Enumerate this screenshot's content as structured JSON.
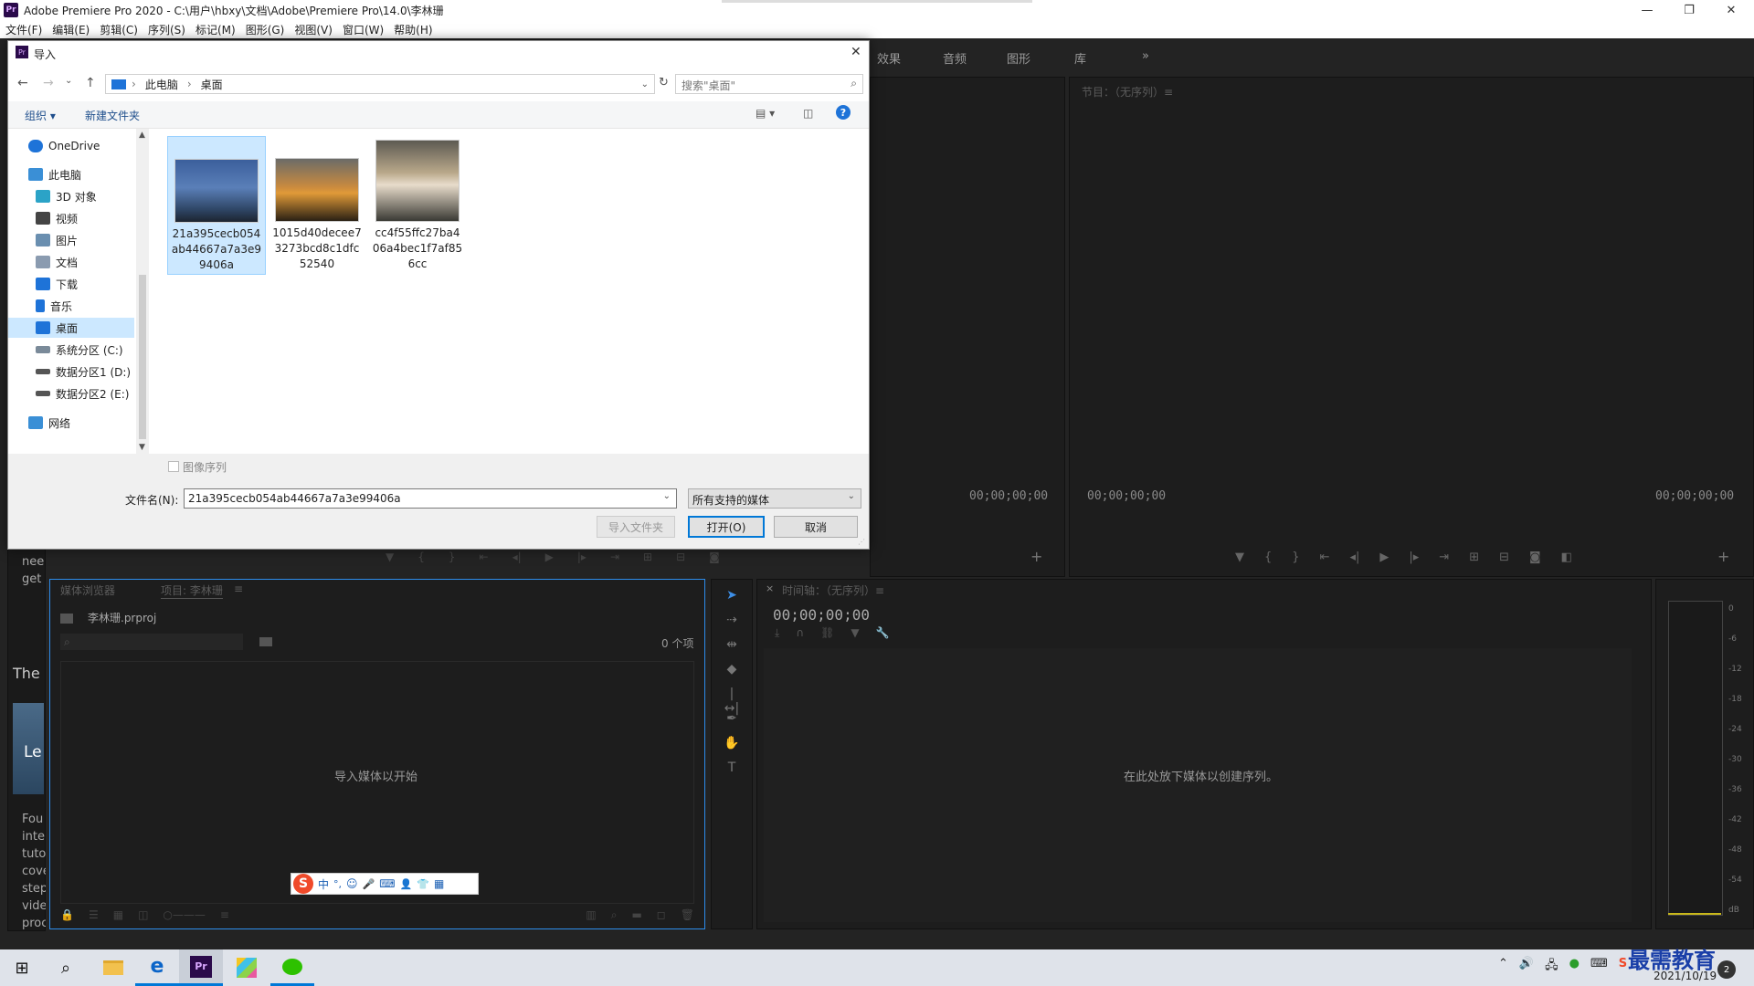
{
  "app": {
    "title": "Adobe Premiere Pro 2020 - C:\\用户\\hbxy\\文档\\Adobe\\Premiere Pro\\14.0\\李林珊",
    "menu": [
      "文件(F)",
      "编辑(E)",
      "剪辑(C)",
      "序列(S)",
      "标记(M)",
      "图形(G)",
      "视图(V)",
      "窗口(W)",
      "帮助(H)"
    ],
    "workspace_tabs": [
      "效果",
      "音频",
      "图形",
      "库",
      "»"
    ]
  },
  "program_monitor": {
    "title": "节目：（无序列）≡",
    "timecode_left": "00;00;00;00",
    "timecode_right": "00;00;00;00"
  },
  "source_monitor": {
    "timecode": "00;00;00;00"
  },
  "left_tutorial": {
    "lines": [
      "nee",
      "get",
      "The",
      "Le",
      "Fou",
      "inte",
      "tuto",
      "cove",
      "step",
      "vide",
      "proc"
    ]
  },
  "project_panel": {
    "tab_media_browser": "媒体浏览器",
    "tab_project": "项目: 李林珊",
    "tab_menu": "≡",
    "project_file": "李林珊.prproj",
    "item_count": "0 个项",
    "empty_hint": "导入媒体以开始"
  },
  "timeline": {
    "close": "×",
    "title": "时间轴：（无序列）≡",
    "timecode": "00;00;00;00",
    "empty_hint": "在此处放下媒体以创建序列。"
  },
  "audio_meter": {
    "labels": [
      "0",
      "-6",
      "-12",
      "-18",
      "-24",
      "-30",
      "-36",
      "-42",
      "-48",
      "-54",
      "dB"
    ]
  },
  "ime_bar": {
    "logo": "S",
    "items": [
      "中",
      "°,",
      "☺",
      "🎤",
      "⌨",
      "👤",
      "👕",
      "▦"
    ]
  },
  "dialog": {
    "title": "导入",
    "close": "✕",
    "breadcrumb": [
      "此电脑",
      "桌面"
    ],
    "search_placeholder": "搜索\"桌面\"",
    "toolbar": {
      "organize": "组织 ▾",
      "new_folder": "新建文件夹",
      "help": "?"
    },
    "nav_items": [
      {
        "label": "OneDrive",
        "color": "#1e73d8"
      },
      {
        "label": "此电脑",
        "color": "#3a8fd6"
      },
      {
        "label": "3D 对象",
        "color": "#2ba3c7"
      },
      {
        "label": "视频",
        "color": "#444444"
      },
      {
        "label": "图片",
        "color": "#6a8fb0"
      },
      {
        "label": "文档",
        "color": "#8a9bb0"
      },
      {
        "label": "下载",
        "color": "#1e73d8"
      },
      {
        "label": "音乐",
        "color": "#1e73d8"
      },
      {
        "label": "桌面",
        "color": "#1e73d8"
      },
      {
        "label": "系统分区 (C:)",
        "color": "#7a8a99"
      },
      {
        "label": "数据分区1 (D:)",
        "color": "#555555"
      },
      {
        "label": "数据分区2 (E:)",
        "color": "#555555"
      },
      {
        "label": "网络",
        "color": "#3a8fd6"
      }
    ],
    "selected_nav": "桌面",
    "files": [
      {
        "name": "21a395cecb054ab44667a7a3e99406a",
        "lines": [
          "21a395cecb054",
          "ab44667a7a3e9",
          "9406a"
        ],
        "selected": true
      },
      {
        "name": "1015d40decee73273bcd8c1dfc52540",
        "lines": [
          "1015d40decee7",
          "3273bcd8c1dfc",
          "52540"
        ],
        "selected": false
      },
      {
        "name": "cc4f55ffc27ba406a4bec1f7af856cc",
        "lines": [
          "cc4f55ffc27ba4",
          "06a4bec1f7af85",
          "6cc"
        ],
        "selected": false
      }
    ],
    "image_sequence_label": "图像序列",
    "filename_label": "文件名(N):",
    "filename_value": "21a395cecb054ab44667a7a3e99406a",
    "filetype_value": "所有支持的媒体",
    "import_folder_button": "导入文件夹",
    "open_button": "打开(O)",
    "cancel_button": "取消"
  },
  "taskbar": {
    "apps": [
      "start",
      "search",
      "file-explorer",
      "edge",
      "premiere",
      "paint",
      "wechat"
    ],
    "clock_time": "",
    "clock_date": "2021/10/19",
    "watermark": "最需教育"
  },
  "colors": {
    "accent_blue": "#0078d7",
    "premiere_purple": "#2a0a4a",
    "panel_bg": "#1d1d1d",
    "selection": "#cce8ff"
  }
}
